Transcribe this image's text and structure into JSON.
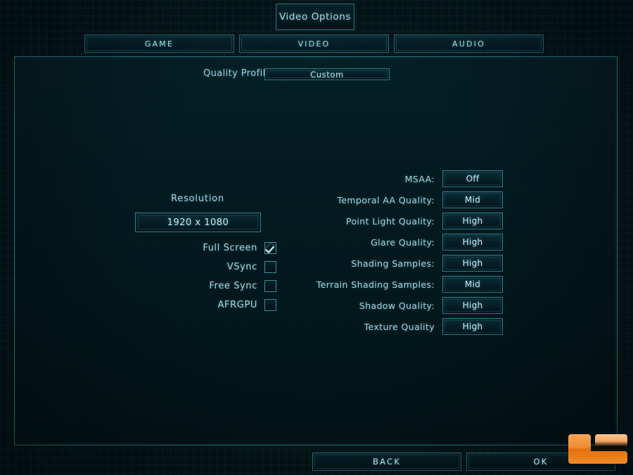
{
  "window": {
    "title": "Video Options"
  },
  "tabs": [
    {
      "label": "GAME"
    },
    {
      "label": "VIDEO"
    },
    {
      "label": "AUDIO"
    }
  ],
  "quality_profile": {
    "label": "Quality Profile",
    "value": "Custom"
  },
  "display": {
    "resolution_label": "Resolution",
    "resolution_value": "1920 x 1080",
    "toggles": [
      {
        "label": "Full Screen",
        "checked": true
      },
      {
        "label": "VSync",
        "checked": false
      },
      {
        "label": "Free Sync",
        "checked": false
      },
      {
        "label": "AFRGPU",
        "checked": false
      }
    ]
  },
  "graphics_options": [
    {
      "label": "MSAA:",
      "value": "Off"
    },
    {
      "label": "Temporal AA Quality:",
      "value": "Mid"
    },
    {
      "label": "Point Light Quality:",
      "value": "High"
    },
    {
      "label": "Glare Quality:",
      "value": "High"
    },
    {
      "label": "Shading Samples:",
      "value": "High"
    },
    {
      "label": "Terrain Shading Samples:",
      "value": "Mid"
    },
    {
      "label": "Shadow Quality:",
      "value": "High"
    },
    {
      "label": "Texture Quality",
      "value": "High"
    }
  ],
  "footer": {
    "back_label": "BACK",
    "ok_label": "OK"
  },
  "watermark": {
    "name": "legit-reviews-logo",
    "color": "#e8761a"
  },
  "colors": {
    "accent": "#2f7c8a",
    "text": "#a8d4dd",
    "text_bright": "#c4e8ef",
    "panel_bg": "#021519",
    "screen_bg": "#04161a"
  }
}
